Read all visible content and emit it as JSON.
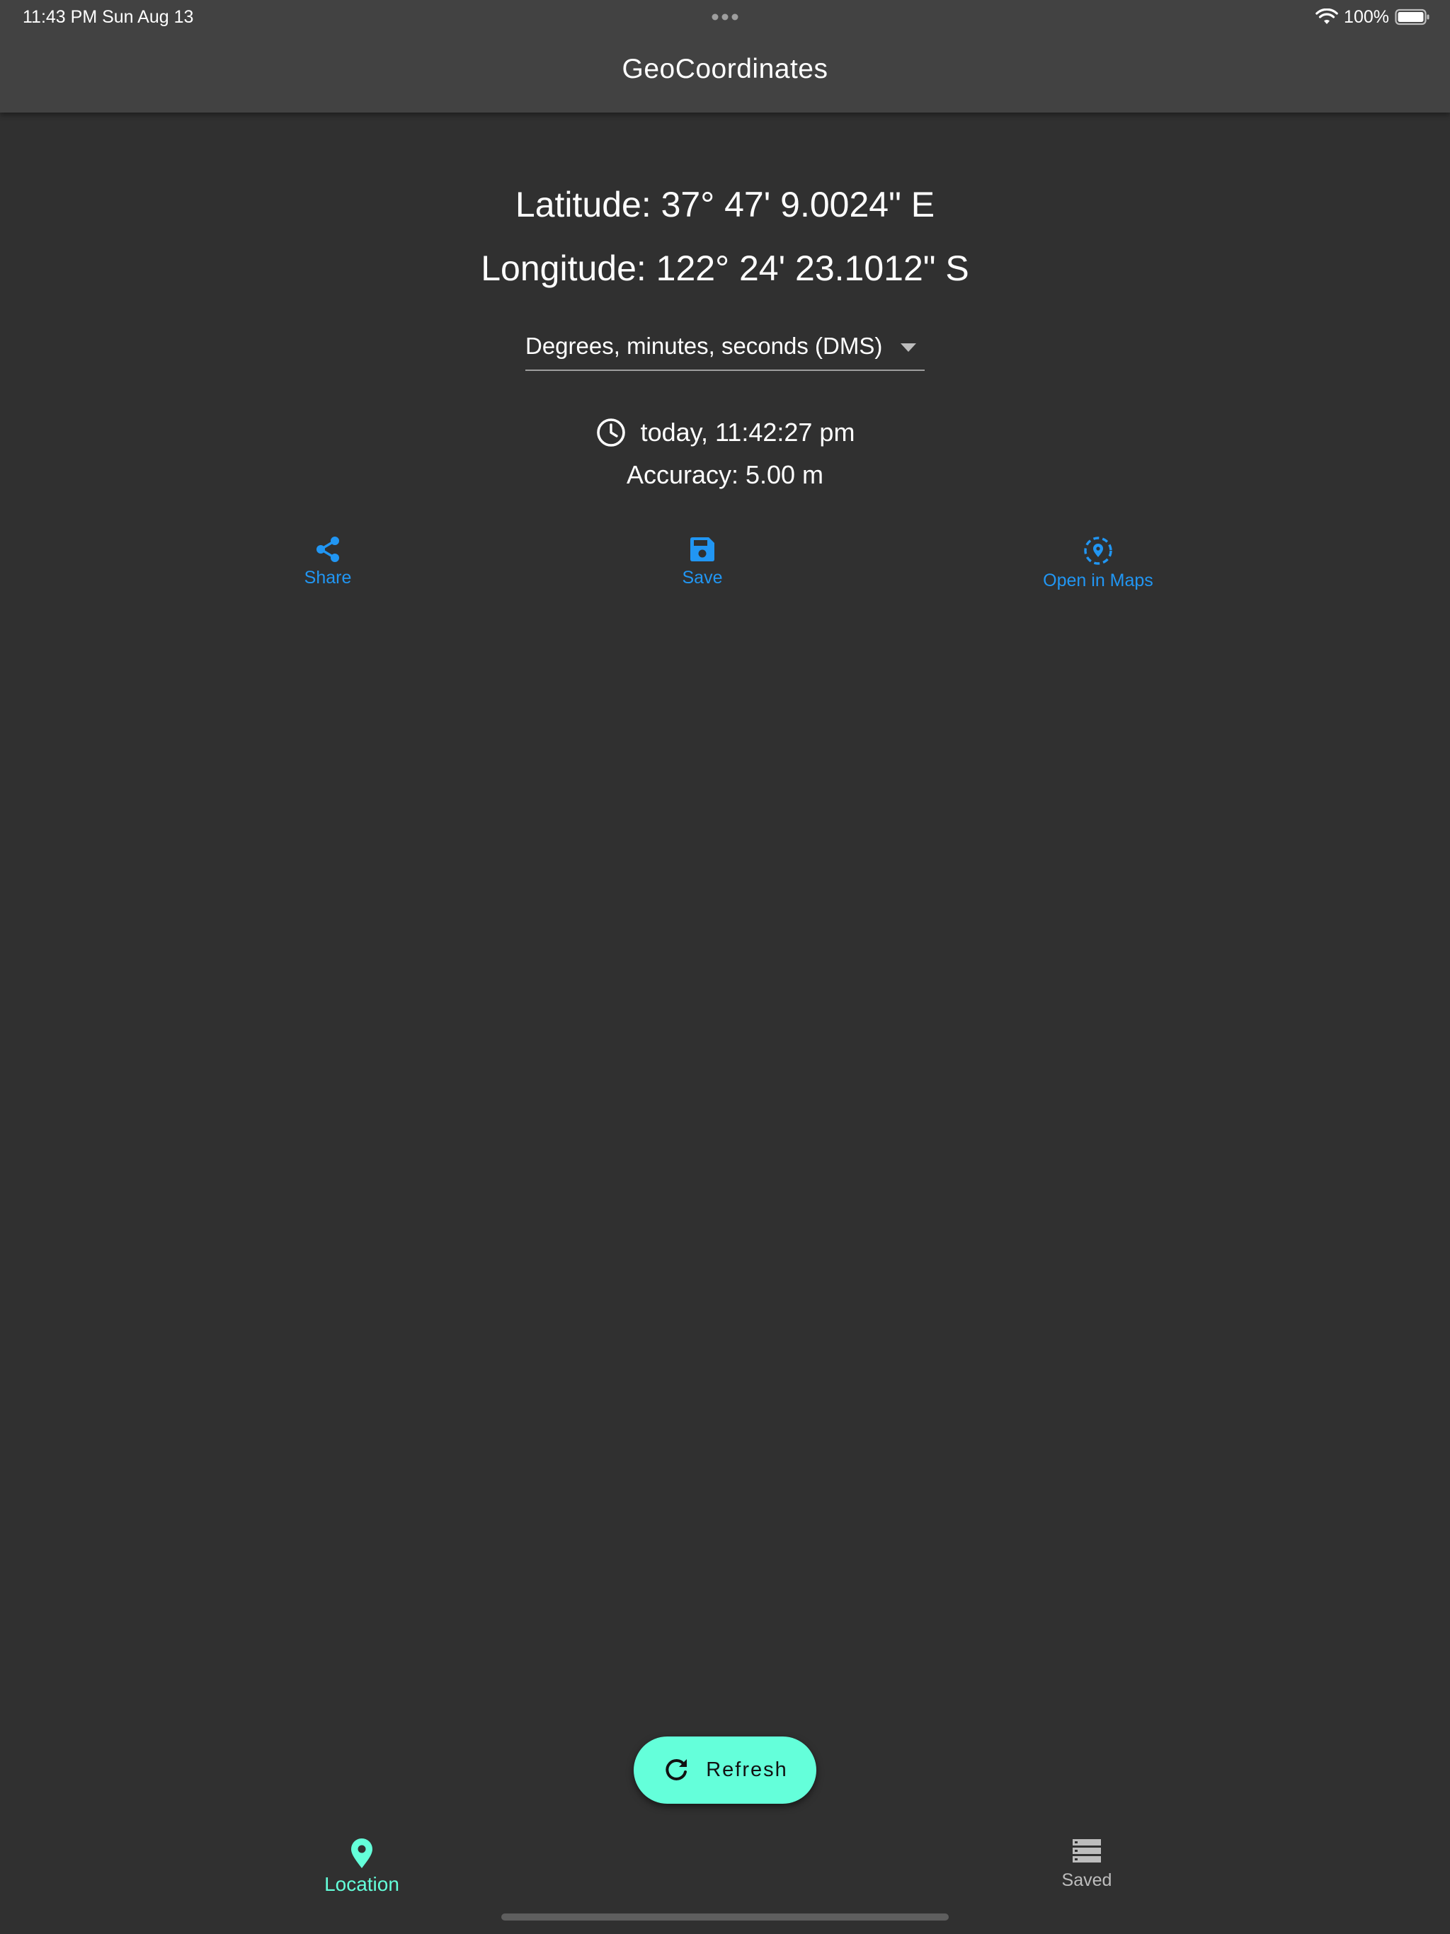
{
  "status_bar": {
    "time_date": "11:43 PM   Sun Aug 13",
    "battery_percent": "100%"
  },
  "app_bar": {
    "title": "GeoCoordinates"
  },
  "location": {
    "latitude": "Latitude: 37° 47' 9.0024\" E",
    "longitude": "Longitude: 122° 24' 23.1012\" S",
    "format_selected": "Degrees, minutes, seconds (DMS)",
    "timestamp": "today, 11:42:27 pm",
    "accuracy": "Accuracy: 5.00 m"
  },
  "actions": {
    "share_label": "Share",
    "save_label": "Save",
    "maps_label": "Open in Maps"
  },
  "fab": {
    "label": "Refresh"
  },
  "bottom_nav": {
    "location_label": "Location",
    "saved_label": "Saved"
  },
  "colors": {
    "background": "#303030",
    "app_bar": "#424242",
    "accent_blue": "#2196f3",
    "accent_teal": "#64ffda"
  },
  "icons": {
    "clock": "clock-icon",
    "share": "share-icon",
    "save": "save-icon",
    "maps": "map-pin-icon",
    "refresh": "refresh-icon",
    "location_nav": "location-pin-icon",
    "saved_nav": "storage-list-icon"
  }
}
